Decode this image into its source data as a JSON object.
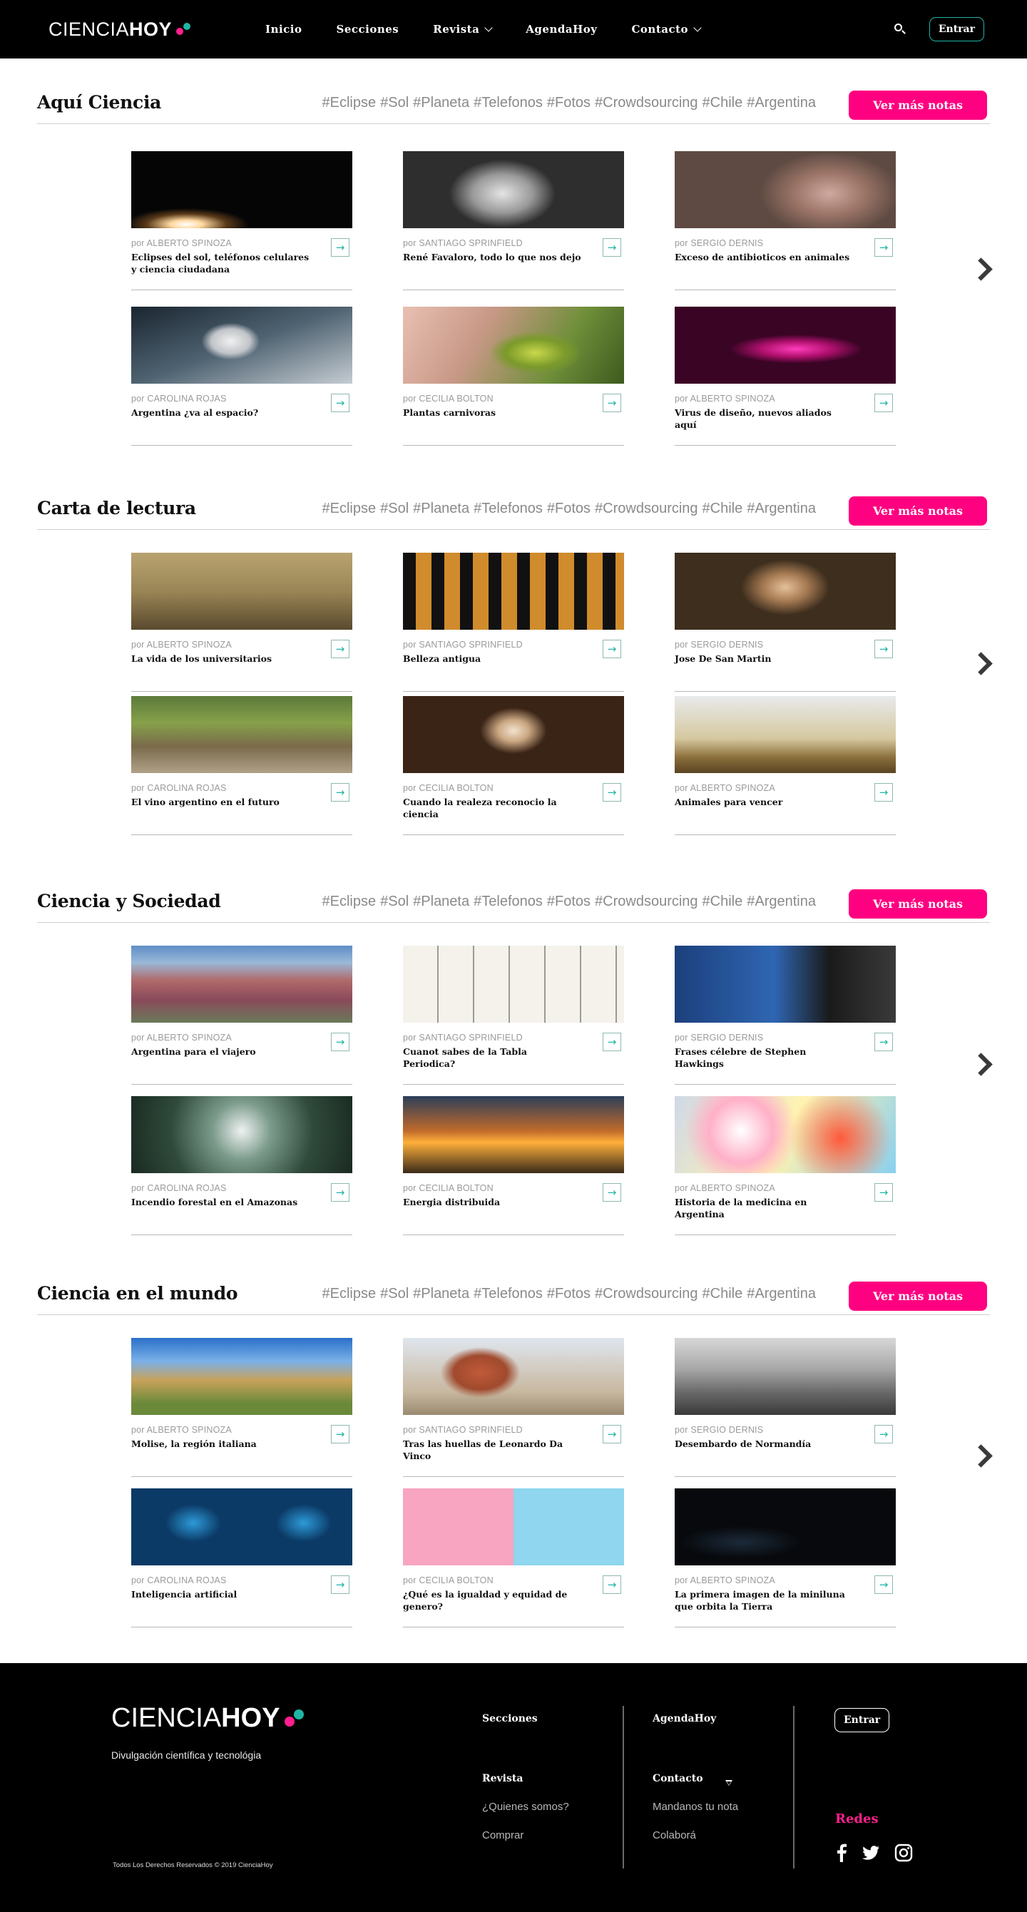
{
  "header": {
    "logo_part1": "CIENCIA",
    "logo_part2": "HOY",
    "nav": [
      {
        "label": "Inicio"
      },
      {
        "label": "Secciones"
      },
      {
        "label": "Revista",
        "dropdown": true
      },
      {
        "label": "AgendaHoy"
      },
      {
        "label": "Contacto",
        "dropdown": true
      }
    ],
    "login_label": "Entrar"
  },
  "tags": [
    "#Eclipse",
    "#Sol",
    "#Planeta",
    "#Telefonos",
    "#Fotos",
    "#Crowdsourcing",
    "#Chile",
    "#Argentina"
  ],
  "more_label": "Ver más notas",
  "sections": [
    {
      "title": "Aquí Ciencia",
      "cards": [
        {
          "author": "por ALBERTO SPINOZA",
          "title": "Eclipses del sol, teléfonos celulares y ciencia ciudadana",
          "image": "eclipse"
        },
        {
          "author": "por SANTIAGO SPRINFIELD",
          "title": "René Favaloro, todo lo que nos dejo",
          "image": "portrait-bw"
        },
        {
          "author": "por SERGIO DERNIS",
          "title": "Exceso de antibioticos en animales",
          "image": "pigs"
        },
        {
          "author": "por CAROLINA ROJAS",
          "title": "Argentina ¿va al espacio?",
          "image": "astronaut"
        },
        {
          "author": "por CECILIA BOLTON",
          "title": "Plantas carnivoras",
          "image": "venus-flytrap"
        },
        {
          "author": "por ALBERTO SPINOZA",
          "title": "Virus de diseño, nuevos aliados aquí",
          "image": "virus"
        }
      ]
    },
    {
      "title": "Carta de lectura",
      "cards": [
        {
          "author": "por ALBERTO SPINOZA",
          "title": "La vida de los universitarios",
          "image": "cloister"
        },
        {
          "author": "por SANTIAGO SPRINFIELD",
          "title": "Belleza antigua",
          "image": "greek-vase"
        },
        {
          "author": "por SERGIO DERNIS",
          "title": "Jose De San Martin",
          "image": "san-martin"
        },
        {
          "author": "por CAROLINA ROJAS",
          "title": "El vino argentino en el futuro",
          "image": "vineyard"
        },
        {
          "author": "por CECILIA BOLTON",
          "title": "Cuando la realeza reconocio la ciencia",
          "image": "royal-portrait"
        },
        {
          "author": "por ALBERTO SPINOZA",
          "title": "Animales para vencer",
          "image": "cat-tree"
        }
      ]
    },
    {
      "title": "Ciencia y Sociedad",
      "cards": [
        {
          "author": "por ALBERTO SPINOZA",
          "title": "Argentina para el viajero",
          "image": "mountains"
        },
        {
          "author": "por SANTIAGO SPRINFIELD",
          "title": "Cuanot sabes de la Tabla Periodica?",
          "image": "periodic-table"
        },
        {
          "author": "por SERGIO DERNIS",
          "title": "Frases célebre de Stephen Hawkings",
          "image": "hawking"
        },
        {
          "author": "por CAROLINA ROJAS",
          "title": "Incendio forestal en el Amazonas",
          "image": "forest"
        },
        {
          "author": "por CECILIA BOLTON",
          "title": "Energia distribuida",
          "image": "power-lines"
        },
        {
          "author": "por ALBERTO SPINOZA",
          "title": "Historia de la medicina en Argentina",
          "image": "pills"
        }
      ]
    },
    {
      "title": "Ciencia en el mundo",
      "cards": [
        {
          "author": "por ALBERTO SPINOZA",
          "title": "Molise, la región italiana",
          "image": "church"
        },
        {
          "author": "por SANTIAGO SPRINFIELD",
          "title": "Tras las huellas de Leonardo Da Vinco",
          "image": "florence"
        },
        {
          "author": "por SERGIO DERNIS",
          "title": "Desembardo de Normandía",
          "image": "normandy"
        },
        {
          "author": "por CAROLINA ROJAS",
          "title": "Inteligencia artificial",
          "image": "ai"
        },
        {
          "author": "por CECILIA BOLTON",
          "title": "¿Qué es la igualdad y equidad de genero?",
          "image": "equality"
        },
        {
          "author": "por ALBERTO SPINOZA",
          "title": "La primera imagen de la miniluna que orbita la Tierra",
          "image": "space-dark"
        }
      ]
    }
  ],
  "footer": {
    "logo_part1": "CIENCIA",
    "logo_part2": "HOY",
    "tagline": "Divulgación científica y tecnológia",
    "copyright": "Todos Los Derechos Reservados © 2019 CienciaHoy",
    "col1": {
      "secciones": "Secciones",
      "revista": "Revista",
      "quienes": "¿Quienes somos?",
      "comprar": "Comprar"
    },
    "col2": {
      "agenda": "AgendaHoy",
      "contacto": "Contacto",
      "mandanos": "Mandanos tu nota",
      "colabora": "Colaborá"
    },
    "login_label": "Entrar",
    "redes_label": "Redes",
    "social_icons": [
      "facebook-icon",
      "twitter-icon",
      "instagram-icon"
    ]
  },
  "colors": {
    "accent_pink": "#ff0080",
    "accent_teal": "#1fb5a5",
    "logo_dot_pink": "#ff1f8e",
    "logo_dot_teal": "#1fb5a5"
  }
}
